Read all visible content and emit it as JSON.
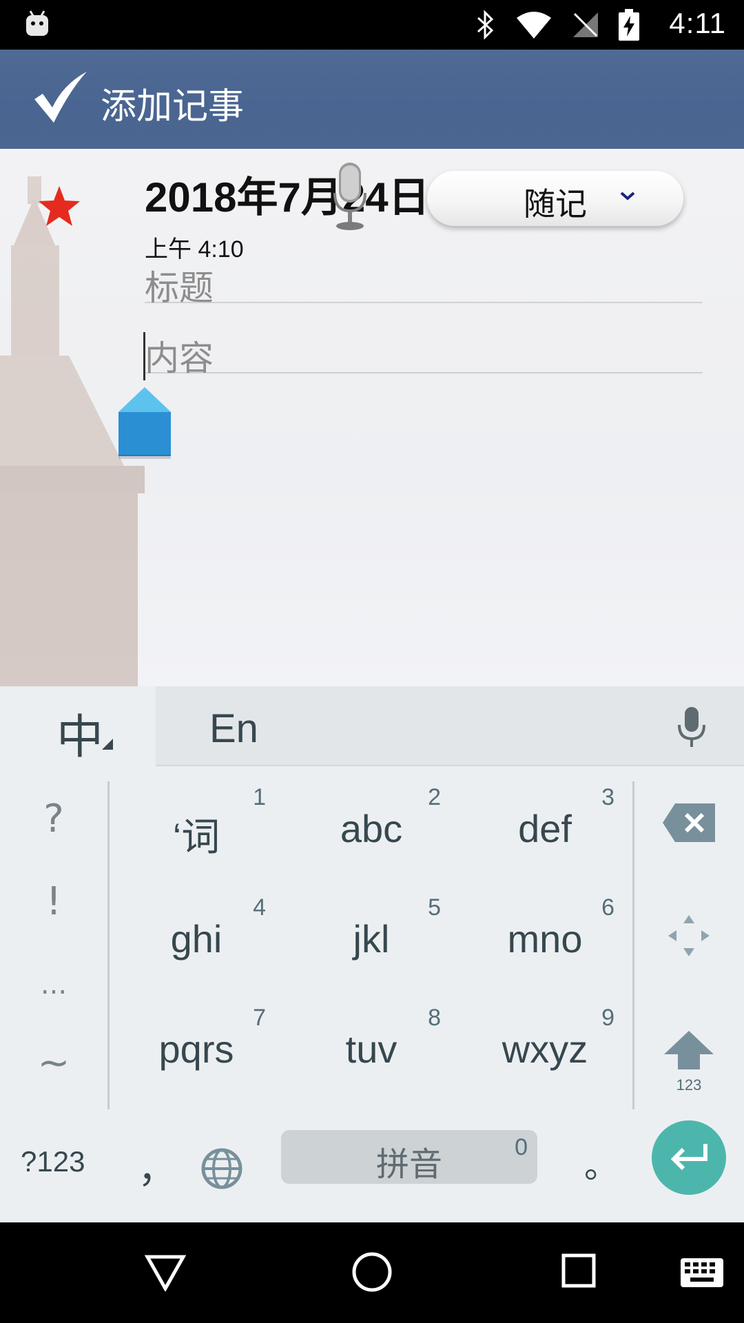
{
  "status_bar": {
    "time": "4:11"
  },
  "app_bar": {
    "title": "添加记事"
  },
  "note": {
    "date": "2018年7月24日",
    "time": "上午 4:10",
    "category": "随记",
    "title_placeholder": "标题",
    "content_placeholder": "内容"
  },
  "keyboard": {
    "lang_label": "中",
    "mode_label": "En",
    "left_symbols": [
      "?",
      "!",
      "...",
      "~"
    ],
    "keys": [
      {
        "label": "‘词",
        "num": "1"
      },
      {
        "label": "abc",
        "num": "2"
      },
      {
        "label": "def",
        "num": "3"
      },
      {
        "label": "ghi",
        "num": "4"
      },
      {
        "label": "jkl",
        "num": "5"
      },
      {
        "label": "mno",
        "num": "6"
      },
      {
        "label": "pqrs",
        "num": "7"
      },
      {
        "label": "tuv",
        "num": "8"
      },
      {
        "label": "wxyz",
        "num": "9"
      }
    ],
    "shift_label": "123",
    "symbols_key": "?123",
    "comma": "，",
    "space_label": "拼音",
    "space_num": "0",
    "period": "。"
  },
  "colors": {
    "app_bar": "#4b6690",
    "accent_enter": "#4db6ac",
    "star": "#e52b1f"
  }
}
